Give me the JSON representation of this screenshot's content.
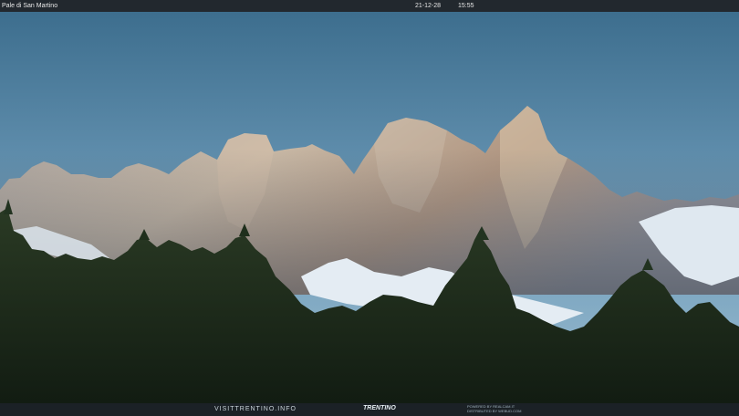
{
  "header": {
    "location": "Pale di San Martino",
    "date": "21-12-28",
    "time": "15:55"
  },
  "footer": {
    "site": "VISITTRENTINO.INFO",
    "brand": "TRENTINO",
    "powered_line1": "POWERED BY REALCAM.IT",
    "powered_line2": "DISTRIBUTED BY WEBUD.COM"
  },
  "colors": {
    "sky_top": "#3e6f8f",
    "sky_bottom": "#86aec7",
    "rock_lit": "#c9b9a6",
    "rock_shadow": "#6f7480",
    "snow": "#e6eef5",
    "forest": "#1a2a1c"
  }
}
